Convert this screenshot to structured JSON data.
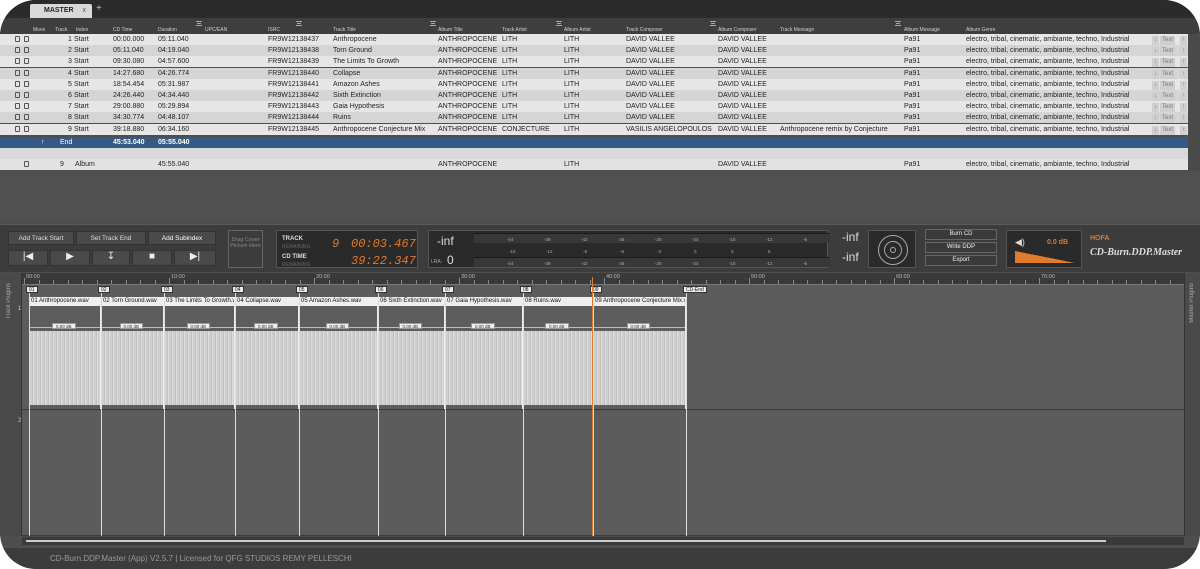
{
  "app": {
    "tab_title": "MASTER",
    "tab_close": "x",
    "new_tab": "+"
  },
  "columns": [
    "Move",
    "Track",
    "Index",
    "CD Time",
    "Duration",
    "UPC/EAN",
    "ISRC",
    "Track Title",
    "Album Title",
    "Track Artist",
    "Album Artist",
    "Track Composer",
    "Album Composer",
    "Track Message",
    "Album Message",
    "Album Genre"
  ],
  "rows": [
    {
      "track": "1",
      "index": "Start",
      "cd_time": "00:00.000",
      "duration": "05:11.040",
      "isrc": "FR9W12138437",
      "title": "Anthropocene",
      "album": "ANTHROPOCENE",
      "artist": "LITH",
      "album_artist": "LITH",
      "composer": "DAVID VALLEE",
      "album_composer": "DAVID VALLEE",
      "message": "",
      "album_message": "Pa91",
      "genre": "electro, tribal, cinematic, ambiante, techno, Industrial"
    },
    {
      "track": "2",
      "index": "Start",
      "cd_time": "05:11.040",
      "duration": "04:19.040",
      "isrc": "FR9W12138438",
      "title": "Torn Ground",
      "album": "ANTHROPOCENE",
      "artist": "LITH",
      "album_artist": "LITH",
      "composer": "DAVID VALLEE",
      "album_composer": "DAVID VALLEE",
      "message": "",
      "album_message": "Pa91",
      "genre": "electro, tribal, cinematic, ambiante, techno, Industrial"
    },
    {
      "track": "3",
      "index": "Start",
      "cd_time": "09:30.080",
      "duration": "04:57.600",
      "isrc": "FR9W12138439",
      "title": "The Limits To Growth",
      "album": "ANTHROPOCENE",
      "artist": "LITH",
      "album_artist": "LITH",
      "composer": "DAVID VALLEE",
      "album_composer": "DAVID VALLEE",
      "message": "",
      "album_message": "Pa91",
      "genre": "electro, tribal, cinematic, ambiante, techno, Industrial"
    },
    {
      "track": "4",
      "index": "Start",
      "cd_time": "14:27.680",
      "duration": "04:26.774",
      "isrc": "FR9W12138440",
      "title": "Collapse",
      "album": "ANTHROPOCENE",
      "artist": "LITH",
      "album_artist": "LITH",
      "composer": "DAVID VALLEE",
      "album_composer": "DAVID VALLEE",
      "message": "",
      "album_message": "Pa91",
      "genre": "electro, tribal, cinematic, ambiante, techno, Industrial"
    },
    {
      "track": "5",
      "index": "Start",
      "cd_time": "18:54.454",
      "duration": "05:31.987",
      "isrc": "FR9W12138441",
      "title": "Amazon Ashes",
      "album": "ANTHROPOCENE",
      "artist": "LITH",
      "album_artist": "LITH",
      "composer": "DAVID VALLEE",
      "album_composer": "DAVID VALLEE",
      "message": "",
      "album_message": "Pa91",
      "genre": "electro, tribal, cinematic, ambiante, techno, Industrial"
    },
    {
      "track": "6",
      "index": "Start",
      "cd_time": "24:26.440",
      "duration": "04:34.440",
      "isrc": "FR9W12138442",
      "title": "Sixth Extinction",
      "album": "ANTHROPOCENE",
      "artist": "LITH",
      "album_artist": "LITH",
      "composer": "DAVID VALLEE",
      "album_composer": "DAVID VALLEE",
      "message": "",
      "album_message": "Pa91",
      "genre": "electro, tribal, cinematic, ambiante, techno, Industrial"
    },
    {
      "track": "7",
      "index": "Start",
      "cd_time": "29:00.880",
      "duration": "05:29.894",
      "isrc": "FR9W12138443",
      "title": "Gaia Hypothesis",
      "album": "ANTHROPOCENE",
      "artist": "LITH",
      "album_artist": "LITH",
      "composer": "DAVID VALLEE",
      "album_composer": "DAVID VALLEE",
      "message": "",
      "album_message": "Pa91",
      "genre": "electro, tribal, cinematic, ambiante, techno, Industrial"
    },
    {
      "track": "8",
      "index": "Start",
      "cd_time": "34:30.774",
      "duration": "04:48.107",
      "isrc": "FR9W12138444",
      "title": "Ruins",
      "album": "ANTHROPOCENE",
      "artist": "LITH",
      "album_artist": "LITH",
      "composer": "DAVID VALLEE",
      "album_composer": "DAVID VALLEE",
      "message": "",
      "album_message": "Pa91",
      "genre": "electro, tribal, cinematic, ambiante, techno, Industrial"
    },
    {
      "track": "9",
      "index": "Start",
      "cd_time": "39:18.880",
      "duration": "06:34.160",
      "isrc": "FR9W12138445",
      "title": "Anthropocene Conjecture Mix",
      "album": "ANTHROPOCENE",
      "artist": "CONJECTURE",
      "album_artist": "LITH",
      "composer": "VASILIS ANGELOPOULOS",
      "album_composer": "DAVID VALLEE",
      "message": "Anthropocene remix by Conjecture",
      "album_message": "Pa91",
      "genre": "electro, tribal, cinematic, ambiante, techno, Industrial"
    }
  ],
  "row_buttons": {
    "down": "↓",
    "text": "Text",
    "up": "↑"
  },
  "end_row": {
    "index": "End",
    "cd_time": "45:53.040",
    "duration": "05:55.040"
  },
  "album_row": {
    "track": "9",
    "label": "Album",
    "duration": "45:55.040",
    "album": "ANTHROPOCENE",
    "album_artist": "LITH",
    "album_composer": "DAVID VALLEE",
    "album_message": "Pa91",
    "genre": "electro, tribal, cinematic, ambiante, techno, Industrial"
  },
  "controls": {
    "add_track_start": "Add Track Start",
    "set_track_end": "Set Track End",
    "add_subindex": "Add Subindex",
    "drag_cover": "Drag Cover Picture Here"
  },
  "display": {
    "track_label": "TRACK",
    "track_sub": "REMAINING",
    "track_num": "9",
    "track_time": "00:03.467",
    "cd_label": "CD TIME",
    "cd_sub": "REMAINING",
    "cd_time": "39:22.347"
  },
  "meter": {
    "inf_left": "-inf",
    "lra_label": "LRA:",
    "lra_value": "0",
    "inf_r1": "-inf",
    "inf_r2": "-inf",
    "scale1": [
      "-54",
      "-48",
      "-42",
      "-36",
      "-30",
      "-24",
      "-18",
      "-12",
      "-6"
    ],
    "scale2": [
      "-15",
      "-12",
      "-9",
      "-6",
      "-3",
      "0",
      "3",
      "6"
    ],
    "scale3": [
      "-54",
      "-48",
      "-42",
      "-36",
      "-30",
      "-24",
      "-18",
      "-12",
      "-6"
    ]
  },
  "output": {
    "burn": "Burn CD",
    "write": "Write DDP",
    "export": "Export",
    "volume": "0.0 dB",
    "brand_small": "HOFA",
    "brand": "CD-Burn.DDP.Master"
  },
  "ruler": [
    "00:00",
    "10:00",
    "20:00",
    "30:00",
    "40:00",
    "50:00",
    "60:00",
    "70:00"
  ],
  "markers": [
    "01",
    "02",
    "03",
    "04",
    "05",
    "06",
    "07",
    "08",
    "09",
    "CD-End"
  ],
  "clips": [
    {
      "name": "01 Anthropocene.wav",
      "gain": "0.00 dB"
    },
    {
      "name": "02 Torn Ground.wav",
      "gain": "0.00 dB"
    },
    {
      "name": "03 The Limits To Growth.wav",
      "gain": "0.00 dB"
    },
    {
      "name": "04 Collapse.wav",
      "gain": "0.00 dB"
    },
    {
      "name": "05 Amazon Ashes.wav",
      "gain": "0.00 dB"
    },
    {
      "name": "06 Sixth Extinction.wav",
      "gain": "0.00 dB"
    },
    {
      "name": "07 Gaia Hypothesis.wav",
      "gain": "0.00 dB"
    },
    {
      "name": "08 Ruins.wav",
      "gain": "0.00 dB"
    },
    {
      "name": "09 Anthropocene Conjecture Mix.wav",
      "gain": "0.00 dB"
    }
  ],
  "side": {
    "track_plugins": "Track Plugins",
    "master_plugins": "Master Plugins",
    "lane1": "1",
    "lane2": "2"
  },
  "status": "CD-Burn.DDP.Master (App) V2.5.7  |  Licensed for QFG STUDIOS REMY PELLESCHI"
}
